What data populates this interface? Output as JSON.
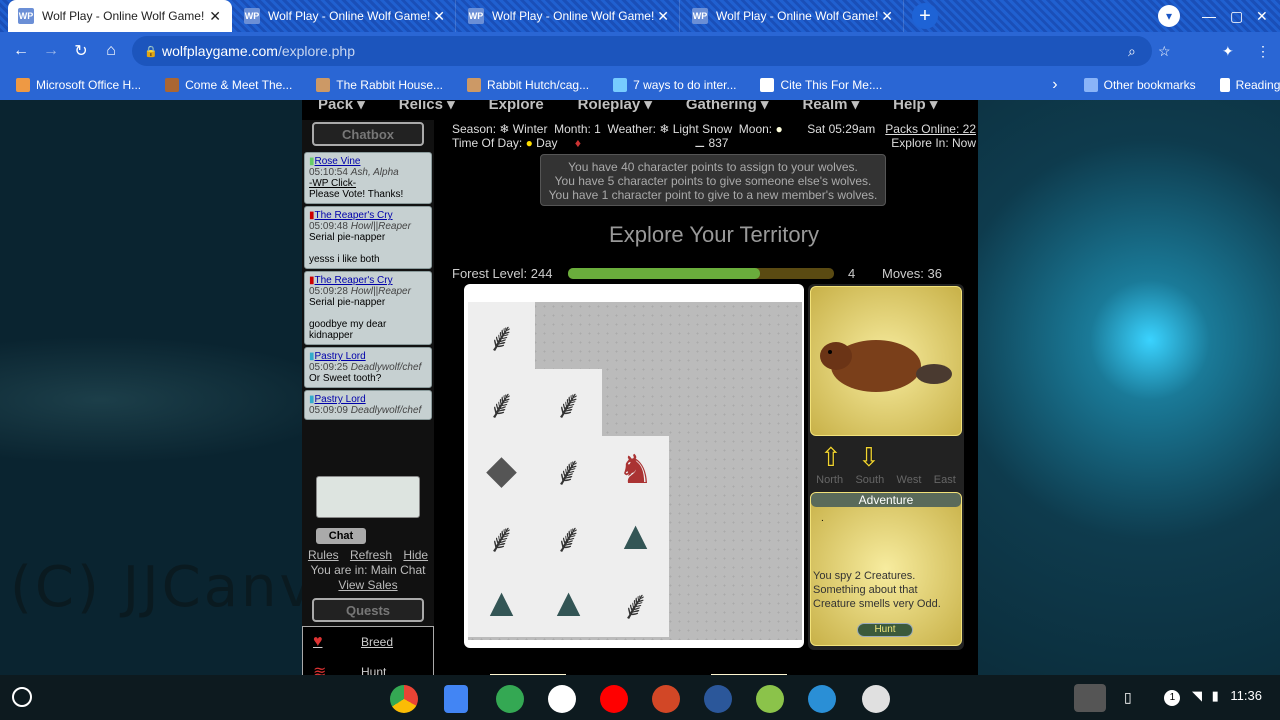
{
  "tabs": [
    {
      "title": "Wolf Play - Online Wolf Game!",
      "active": true
    },
    {
      "title": "Wolf Play - Online Wolf Game!"
    },
    {
      "title": "Wolf Play - Online Wolf Game!"
    },
    {
      "title": "Wolf Play - Online Wolf Game!"
    }
  ],
  "browser": {
    "url_host": "wolfplaygame.com",
    "url_path": "/explore.php"
  },
  "bookmarks": [
    "Microsoft Office H...",
    "Come & Meet The...",
    "The Rabbit House...",
    "Rabbit Hutch/cag...",
    "7 ways to do inter...",
    "Cite This For Me:...",
    "Other bookmarks",
    "Reading list"
  ],
  "nav": [
    "Pack ▾",
    "Relics ▾",
    "Explore",
    "Roleplay ▾",
    "Gathering ▾",
    "Realm ▾",
    "Help ▾"
  ],
  "chatbox_label": "Chatbox",
  "chat": [
    {
      "name": "Rose Vine",
      "time": "05:10:54",
      "rank": "Ash, Alpha",
      "text1": "-WP Click-",
      "text2": "Please Vote! Thanks!"
    },
    {
      "name": "The Reaper's Cry",
      "time": "05:09:48",
      "rank": "Howl||Reaper",
      "text1": "Serial pie-napper",
      "text2": "yesss i like both"
    },
    {
      "name": "The Reaper's Cry",
      "time": "05:09:28",
      "rank": "Howl||Reaper",
      "text1": "Serial pie-napper",
      "text2": "goodbye my dear kidnapper"
    },
    {
      "name": "Pastry Lord",
      "time": "05:09:25",
      "rank": "Deadlywolf/chef",
      "text1": "Or Sweet tooth?",
      "text2": ""
    },
    {
      "name": "Pastry Lord",
      "time": "05:09:09",
      "rank": "Deadlywolf/chef",
      "text1": "",
      "text2": ""
    }
  ],
  "chat_button": "Chat",
  "chat_links": {
    "rules": "Rules",
    "refresh": "Refresh",
    "hide": "Hide",
    "location": "You are in: Main Chat",
    "sales": "View Sales"
  },
  "quests_label": "Quests",
  "quests": [
    {
      "label": "Breed"
    },
    {
      "label": "Hunt"
    }
  ],
  "status": {
    "season": "Season:",
    "season_val": "Winter",
    "month": "Month: 1",
    "weather": "Weather:",
    "weather_val": "Light Snow",
    "moon": "Moon:",
    "time_of_day": "Time Of Day:",
    "day": "Day",
    "bones": "837",
    "datetime": "Sat 05:29am",
    "packs_online": "Packs Online: 22",
    "explore_in": "Explore In: Now"
  },
  "points": [
    "You have 40 character points to assign to your wolves.",
    "You have 5 character points to give someone else's wolves.",
    "You have 1 character point to give to a new member's wolves."
  ],
  "heading": "Explore Your Territory",
  "forest": {
    "label": "Forest Level: 244",
    "progress": 0.72,
    "count": "4",
    "moves": "Moves: 36"
  },
  "directions": [
    "North",
    "South",
    "West",
    "East"
  ],
  "adventure": {
    "title": "Adventure",
    "dot": ".",
    "text": "You spy 2 Creatures. Something about that Creature smells very Odd.",
    "hunt": "Hunt"
  },
  "watermark": "(C) JJCanvas",
  "clock": "11:36",
  "notif_count": "1"
}
